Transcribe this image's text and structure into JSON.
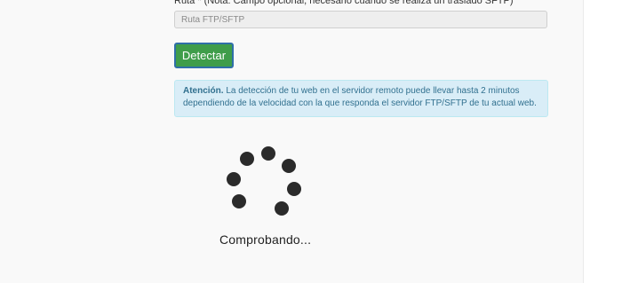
{
  "form": {
    "path_label": "Ruta * (Nota: Campo opcional, necesario cuando se realiza un traslado SFTP)",
    "path_placeholder": "Ruta FTP/SFTP",
    "path_value": "",
    "detect_button": "Detectar"
  },
  "alert": {
    "title": "Atención.",
    "message": "La detección de tu web en el servidor remoto puede llevar hasta 2 minutos dependiendo de la velocidad con la que responda el servidor FTP/SFTP de tu actual web."
  },
  "loader": {
    "status": "Comprobando..."
  },
  "colors": {
    "button_green": "#3f9d4a",
    "button_focus_border": "#2f6fa8",
    "alert_background": "#d9edf7",
    "alert_text": "#31708f",
    "spinner_dot": "#2b2b2b"
  }
}
